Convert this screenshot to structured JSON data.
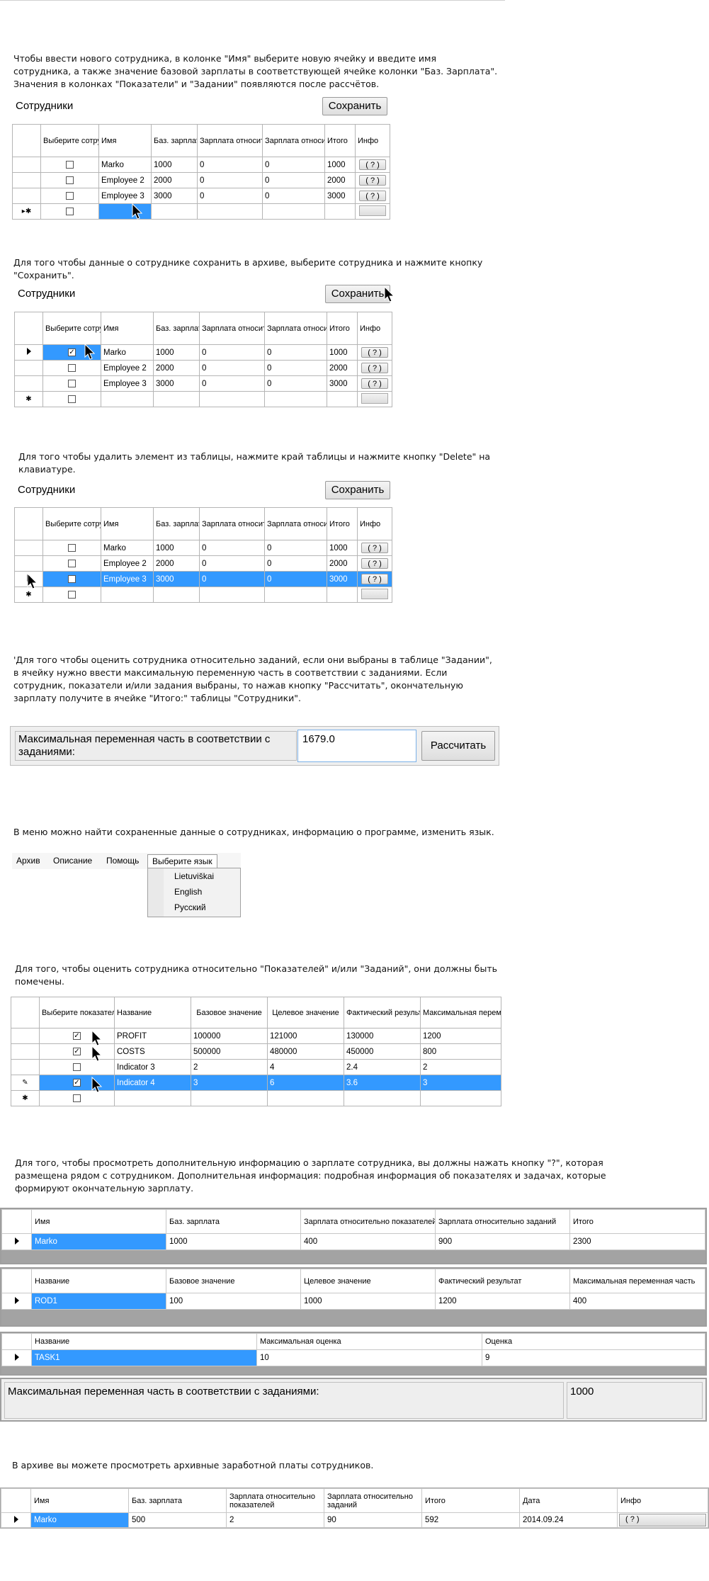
{
  "sections": [
    {
      "paragraph": [
        "Чтобы ввести нового сотрудника, в колонке \"Имя\" выберите новую ячейку и введите имя",
        "сотрудника, а также значение базовой зарплаты в соответствующей ячейке колонки \"Баз. Зарплата\".",
        "Значения в колонках \"Показатели\" и \"Задании\" появляются после рассчётов."
      ],
      "title": "Сотрудники",
      "save_label": "Сохранить"
    },
    {
      "paragraph": [
        "Для того чтобы данные о сотруднике сохранить в архиве, выберите сотрудника и нажмите кнопку",
        "\"Сохранить\"."
      ],
      "title": "Сотрудники",
      "save_label": "Сохранить"
    },
    {
      "paragraph": [
        "Для того чтобы удалить элемент из таблицы, нажмите край таблицы и нажмите кнопку \"Delete\" на",
        "клавиатуре."
      ],
      "title": "Сотрудники",
      "save_label": "Сохранить"
    }
  ],
  "employee_grid": {
    "headers": [
      "Выберите сотрудника",
      "Имя",
      "Баз. зарплата",
      "Зарплата относительно показателей",
      "Зарплата относительно заданий",
      "Итого",
      "Инфо"
    ],
    "rows": [
      {
        "name": "Marko",
        "base": "1000",
        "ind": "0",
        "task": "0",
        "total": "1000",
        "info": "( ? )"
      },
      {
        "name": "Employee 2",
        "base": "2000",
        "ind": "0",
        "task": "0",
        "total": "2000",
        "info": "( ? )"
      },
      {
        "name": "Employee 3",
        "base": "3000",
        "ind": "0",
        "task": "0",
        "total": "3000",
        "info": "( ? )"
      }
    ]
  },
  "calc": {
    "paragraph": [
      "'Для того чтобы оценить сотрудника относительно заданий, если они выбраны в таблице \"Задании\",",
      "в ячейку нужно ввести максимальную переменную часть в соответствии с заданиями. Если",
      "сотрудник, показатели и/или задания выбраны, то нажав кнопку \"Рассчитать\", окончательную",
      "зарплату получите в ячейке \"Итого:\" таблицы \"Сотрудники\"."
    ],
    "label": "Максимальная переменная часть в соответствии с заданиями:",
    "value": "1679.0",
    "button": "Рассчитать"
  },
  "menu": {
    "paragraph": "В меню можно найти сохраненные данные о сотрудниках, информацию о программе, изменить язык.",
    "items": [
      "Архив",
      "Описание",
      "Помощь",
      "Выберите язык"
    ],
    "languages": [
      "Lietuviškai",
      "English",
      "Русский"
    ]
  },
  "indicators": {
    "paragraph": [
      "Для того, чтобы оценить сотрудника относительно \"Показателей\" и/или \"Заданий\", они должны быть",
      "помечены."
    ],
    "headers": [
      "Выберите показатели",
      "Название",
      "Базовое значение",
      "Целевое значение",
      "Фактический результат",
      "Максимальная переменная часть"
    ],
    "rows": [
      {
        "checked": true,
        "name": "PROFIT",
        "base": "100000",
        "target": "121000",
        "actual": "130000",
        "max": "1200"
      },
      {
        "checked": true,
        "name": "COSTS",
        "base": "500000",
        "target": "480000",
        "actual": "450000",
        "max": "800"
      },
      {
        "checked": false,
        "name": "Indicator 3",
        "base": "2",
        "target": "4",
        "actual": "2.4",
        "max": "2"
      },
      {
        "checked": true,
        "name": "Indicator 4",
        "base": "3",
        "target": "6",
        "actual": "3.6",
        "max": "3"
      }
    ]
  },
  "details": {
    "paragraph": [
      "Для того, чтобы просмотреть дополнительную информацию о зарплате  сотрудника, вы должны нажать кнопку \"?\", которая",
      "размещена рядом с сотрудником. Дополнительная информация: подробная информация об показателях и  задачах, которые",
      "формируют  окончательную зарплату."
    ],
    "emp_headers": [
      "Имя",
      "Баз. зарплата",
      "Зарплата относительно показателей",
      "Зарплата относительно заданий",
      "Итого"
    ],
    "emp_row": [
      "Marko",
      "1000",
      "400",
      "900",
      "2300"
    ],
    "ind_headers": [
      "Название",
      "Базовое значение",
      "Целевое значение",
      "Фактический результат",
      "Максимальная переменная часть"
    ],
    "ind_row": [
      "ROD1",
      "100",
      "1000",
      "1200",
      "400"
    ],
    "task_headers": [
      "Название",
      "Максимальная оценка",
      "Оценка"
    ],
    "task_row": [
      "TASK1",
      "10",
      "9"
    ],
    "max_label": "Максимальная переменная часть в соответствии с заданиями:",
    "max_value": "1000"
  },
  "archive": {
    "paragraph": "В архиве вы можете просмотреть архивные заработной платы сотрудников.",
    "headers": [
      "Имя",
      "Баз. зарплата",
      "Зарплата относительно показателей",
      "Зарплата относительно заданий",
      "Итого",
      "Дата",
      "Инфо"
    ],
    "row": [
      "Marko",
      "500",
      "2",
      "90",
      "592",
      "2014.09.24",
      "( ? )"
    ]
  }
}
